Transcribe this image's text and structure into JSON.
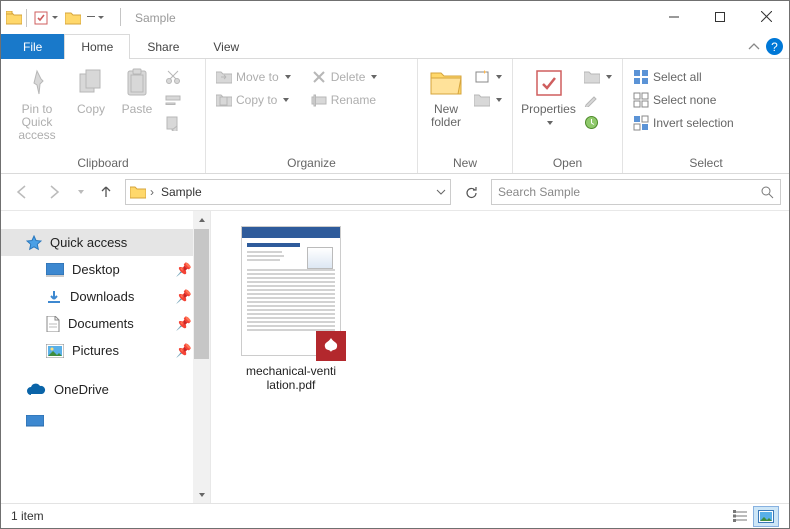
{
  "window": {
    "title": "Sample"
  },
  "tabs": {
    "file": "File",
    "home": "Home",
    "share": "Share",
    "view": "View"
  },
  "ribbon": {
    "clipboard": {
      "pin": "Pin to Quick access",
      "copy": "Copy",
      "paste": "Paste",
      "label": "Clipboard"
    },
    "organize": {
      "moveto": "Move to",
      "copyto": "Copy to",
      "delete": "Delete",
      "rename": "Rename",
      "label": "Organize"
    },
    "new": {
      "folder": "New folder",
      "label": "New"
    },
    "open": {
      "properties": "Properties",
      "label": "Open"
    },
    "select": {
      "all": "Select all",
      "none": "Select none",
      "invert": "Invert selection",
      "label": "Select"
    }
  },
  "address": {
    "current": "Sample"
  },
  "search": {
    "placeholder": "Search Sample"
  },
  "sidebar": {
    "quick": "Quick access",
    "desktop": "Desktop",
    "downloads": "Downloads",
    "documents": "Documents",
    "pictures": "Pictures",
    "onedrive": "OneDrive"
  },
  "files": {
    "item1": "mechanical-venti lation.pdf"
  },
  "status": {
    "count": "1 item"
  }
}
